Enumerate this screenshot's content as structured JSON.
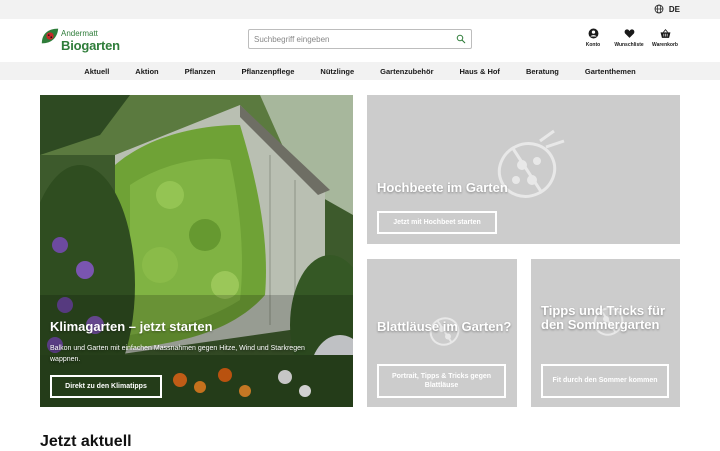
{
  "topbar": {
    "language": "DE"
  },
  "brand": {
    "line1": "Andermatt",
    "line2": "Biogarten",
    "color": "#2f7d3a"
  },
  "search": {
    "placeholder": "Suchbegriff eingeben",
    "value": ""
  },
  "header_icons": [
    {
      "label": "Konto",
      "icon": "user-icon"
    },
    {
      "label": "Wunschliste",
      "icon": "heart-icon"
    },
    {
      "label": "Warenkorb",
      "icon": "basket-icon"
    }
  ],
  "nav": [
    "Aktuell",
    "Aktion",
    "Pflanzen",
    "Pflanzenpflege",
    "Nützlinge",
    "Gartenzubehör",
    "Haus & Hof",
    "Beratung",
    "Gartenthemen"
  ],
  "tiles": {
    "klima": {
      "title": "Klimagarten – jetzt starten",
      "description": "Balkon und Garten mit einfachen Massnahmen gegen Hitze, Wind und Starkregen wappnen.",
      "button": "Direkt zu den Klimatipps"
    },
    "hochbeete": {
      "title": "Hochbeete im Garten",
      "button": "Jetzt mit Hochbeet starten"
    },
    "blattlaeuse": {
      "title": "Blattläuse im Garten?",
      "button": "Portrait, Tipps & Tricks gegen Blattläuse"
    },
    "tipps": {
      "title": "Tipps und Tricks für den Sommergarten",
      "button": "Fit durch den Sommer kommen"
    }
  },
  "section": {
    "title": "Jetzt aktuell"
  }
}
